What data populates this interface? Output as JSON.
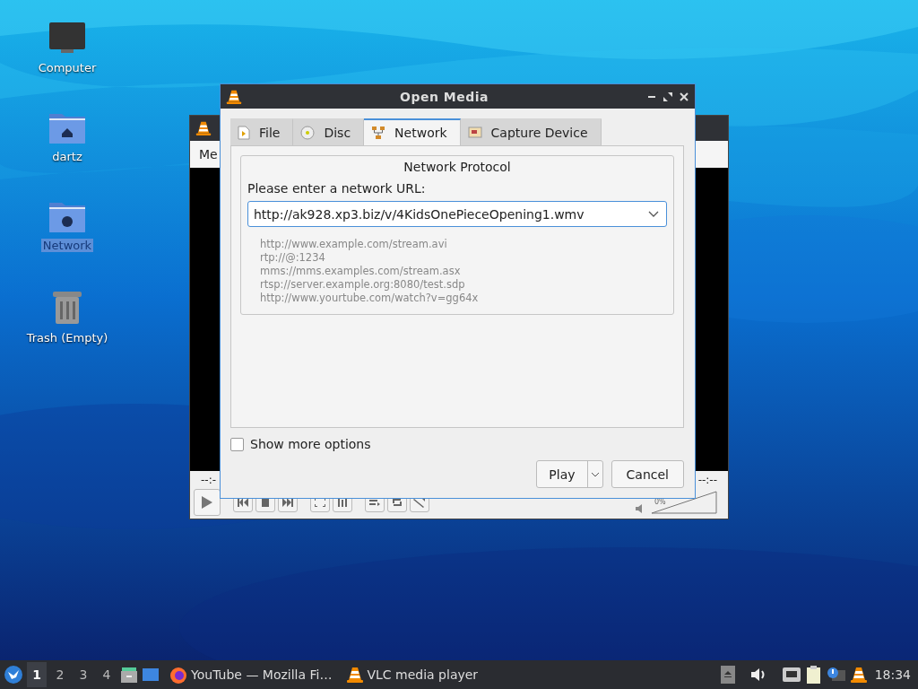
{
  "desktop_icons": [
    {
      "label": "Computer",
      "kind": "computer",
      "selected": false
    },
    {
      "label": "dartz",
      "kind": "home",
      "selected": false
    },
    {
      "label": "Network",
      "kind": "network",
      "selected": true
    },
    {
      "label": "Trash (Empty)",
      "kind": "trash",
      "selected": false
    }
  ],
  "background_window": {
    "menu_text": "Me",
    "elapsed": "--:-",
    "total": "--:--",
    "volume_label": "0%",
    "volume": {
      "level": 0
    }
  },
  "dialog": {
    "title": "Open Media",
    "tabs": [
      {
        "label": "File",
        "kind": "file",
        "selected": false
      },
      {
        "label": "Disc",
        "kind": "disc",
        "selected": false
      },
      {
        "label": "Network",
        "kind": "network",
        "selected": true
      },
      {
        "label": "Capture Device",
        "kind": "capture",
        "selected": false
      }
    ],
    "group_title": "Network Protocol",
    "url_label": "Please enter a network URL:",
    "url": {
      "value": "http://ak928.xp3.biz/v/4KidsOnePieceOpening1.wmv"
    },
    "examples": [
      "http://www.example.com/stream.avi",
      "rtp://@:1234",
      "mms://mms.examples.com/stream.asx",
      "rtsp://server.example.org:8080/test.sdp",
      "http://www.yourtube.com/watch?v=gg64x"
    ],
    "show_more_options": {
      "label": "Show more options",
      "checked": false
    },
    "play": "Play",
    "cancel": "Cancel"
  },
  "taskbar": {
    "workspaces": [
      {
        "label": "1",
        "selected": true
      },
      {
        "label": "2",
        "selected": false
      },
      {
        "label": "3",
        "selected": false
      },
      {
        "label": "4",
        "selected": false
      }
    ],
    "tasks": [
      {
        "label": "YouTube — Mozilla Fi…",
        "kind": "firefox"
      },
      {
        "label": "VLC media player",
        "kind": "vlc"
      }
    ],
    "clock": "18:34"
  }
}
